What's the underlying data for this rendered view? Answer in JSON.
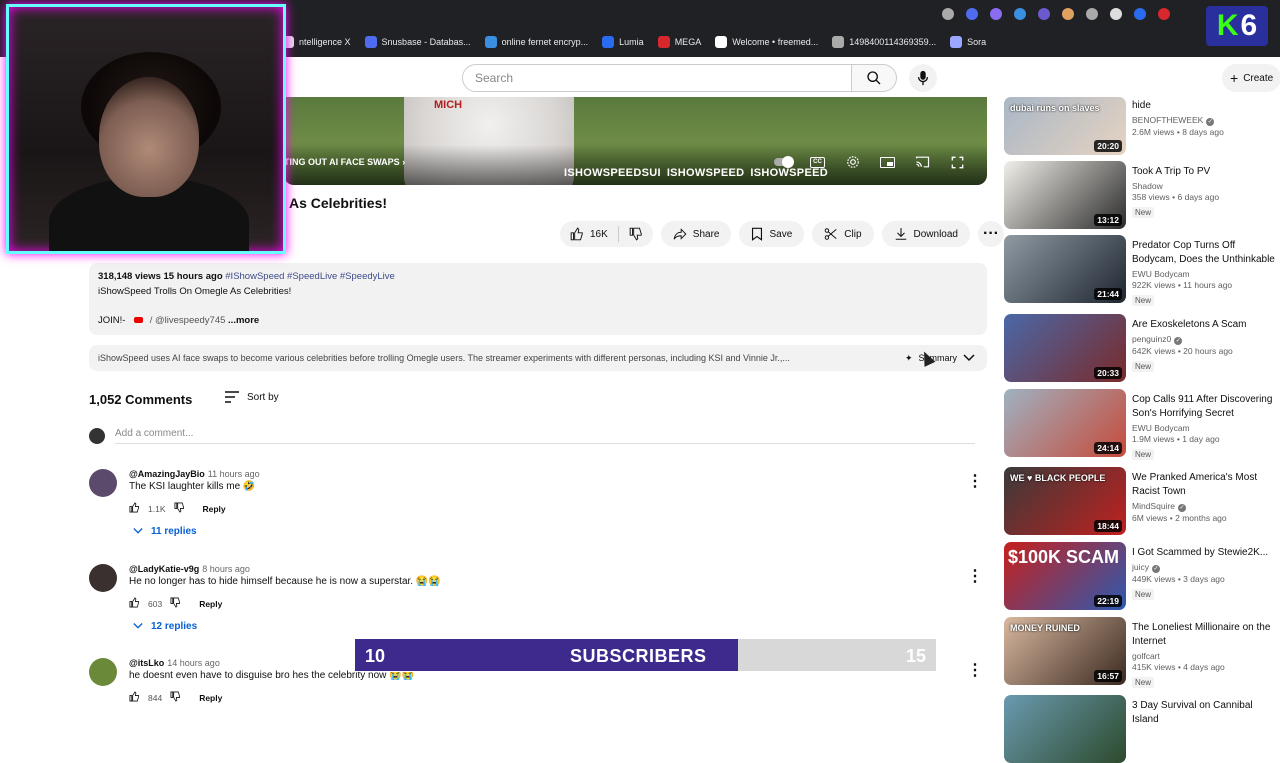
{
  "browser": {
    "bookmarks": [
      {
        "label": "ntelligence X",
        "icon": "intelx-icon",
        "color": "#e0e0e0"
      },
      {
        "label": "Snusbase - Databas...",
        "icon": "snusbase-icon",
        "color": "#4f6cf0"
      },
      {
        "label": "online fernet encryp...",
        "icon": "fernet-icon",
        "color": "#3b8fe0"
      },
      {
        "label": "Lumia",
        "icon": "lumia-icon",
        "color": "#2a6cf0"
      },
      {
        "label": "MEGA",
        "icon": "mega-icon",
        "color": "#d9272e"
      },
      {
        "label": "Welcome • freemed...",
        "icon": "play-icon",
        "color": "#ffffff"
      },
      {
        "label": "1498400114369359...",
        "icon": "globe-icon",
        "color": "#aaaaaa"
      },
      {
        "label": "Sora",
        "icon": "sora-icon",
        "color": "#9aa6ff"
      }
    ],
    "ext_badge": {
      "left": "K",
      "right": "6"
    }
  },
  "yt": {
    "search_placeholder": "Search",
    "create_label": "Create"
  },
  "player": {
    "chapter": "TING OUT AI FACE SWAPS",
    "handles": [
      "ISHOWSPEEDSUI",
      "ISHOWSPEED",
      "ISHOWSPEED"
    ],
    "shirt_letters": "MICH"
  },
  "video": {
    "title": "As Celebrities!",
    "likes": "16K",
    "share": "Share",
    "save": "Save",
    "clip": "Clip",
    "download": "Download"
  },
  "description": {
    "stats": "318,148 views  15 hours ago",
    "tags": "#IShowSpeed #SpeedLive #SpeedyLive",
    "line1": "iShowSpeed Trolls On Omegle As Celebrities!",
    "join": "JOIN!-",
    "channel_link": "/ @livespeedy745",
    "more": "...more"
  },
  "summary": {
    "text": "iShowSpeed uses AI face swaps to become various celebrities before trolling Omegle users. The streamer experiments with different personas, including KSI and Vinnie Jr.,...",
    "button": "Summary"
  },
  "comments": {
    "count": "1,052 Comments",
    "sort_label": "Sort by",
    "add_placeholder": "Add a comment...",
    "items": [
      {
        "user": "@AmazingJayBio",
        "time": "11 hours ago",
        "text": "The KSI laughter kills me 🤣",
        "likes": "1.1K",
        "reply": "Reply",
        "replies": "11 replies",
        "avatar_color": "#5b4a6b"
      },
      {
        "user": "@LadyKatie-v9g",
        "time": "8 hours ago",
        "text": "He no longer has to hide himself because he is now a superstar. 😭😭",
        "likes": "603",
        "reply": "Reply",
        "replies": "12 replies",
        "avatar_color": "#3a3030"
      },
      {
        "user": "@itsLko",
        "time": "14 hours ago",
        "text": "he doesnt even have to disguise bro hes the celebrity now 😭😭",
        "likes": "844",
        "reply": "Reply",
        "replies": "",
        "avatar_color": "#6a8a3a"
      }
    ]
  },
  "subscribers": {
    "current": "10",
    "label": "SUBSCRIBERS",
    "goal": "15",
    "progress": 0.66
  },
  "sidebar": [
    {
      "title": "hide",
      "channel": "BENOFTHEWEEK",
      "verified": true,
      "stats": "2.6M views • 8 days ago",
      "new": "",
      "duration": "20:20",
      "thumb_text": "dubai runs on slaves",
      "colors": [
        "#a9b7c6",
        "#e6d3c1"
      ]
    },
    {
      "title": "Took A Trip To PV",
      "channel": "Shadow",
      "verified": false,
      "stats": "358 views • 6 days ago",
      "new": "New",
      "duration": "13:12",
      "thumb_text": "",
      "colors": [
        "#f1efe9",
        "#2b2b2b"
      ]
    },
    {
      "title": "Predator Cop Turns Off Bodycam, Does the Unthinkable",
      "channel": "EWU Bodycam",
      "verified": false,
      "stats": "922K views • 11 hours ago",
      "new": "New",
      "duration": "21:44",
      "thumb_text": "",
      "colors": [
        "#8f9aa3",
        "#1e2630"
      ]
    },
    {
      "title": "Are Exoskeletons A Scam",
      "channel": "penguinz0",
      "verified": true,
      "stats": "642K views • 20 hours ago",
      "new": "New",
      "duration": "20:33",
      "thumb_text": "",
      "colors": [
        "#4a68a8",
        "#7a2a2a"
      ]
    },
    {
      "title": "Cop Calls 911 After Discovering Son's Horrifying Secret",
      "channel": "EWU Bodycam",
      "verified": false,
      "stats": "1.9M views • 1 day ago",
      "new": "New",
      "duration": "24:14",
      "thumb_text": "",
      "colors": [
        "#9fb2c2",
        "#c64a3a"
      ]
    },
    {
      "title": "We Pranked America's Most Racist Town",
      "channel": "MindSquire",
      "verified": true,
      "stats": "6M views • 2 months ago",
      "new": "",
      "duration": "18:44",
      "thumb_text": "WE ♥ BLACK PEOPLE",
      "colors": [
        "#3a3a3a",
        "#c02020"
      ]
    },
    {
      "title": "I Got Scammed by Stewie2K...",
      "channel": "juicy",
      "verified": true,
      "stats": "449K views • 3 days ago",
      "new": "New",
      "duration": "22:19",
      "thumb_text": "$100K SCAM",
      "colors": [
        "#c7201c",
        "#2d5ab0"
      ]
    },
    {
      "title": "The Loneliest Millionaire on the Internet",
      "channel": "golfcart",
      "verified": false,
      "stats": "415K views • 4 days ago",
      "new": "New",
      "duration": "16:57",
      "thumb_text": "MONEY RUINED",
      "colors": [
        "#d8b8a0",
        "#3b2a20"
      ]
    },
    {
      "title": "3 Day Survival on Cannibal Island",
      "channel": "",
      "verified": false,
      "stats": "",
      "new": "",
      "duration": "",
      "thumb_text": "",
      "colors": [
        "#6a9ab0",
        "#2c4a2c"
      ]
    }
  ]
}
